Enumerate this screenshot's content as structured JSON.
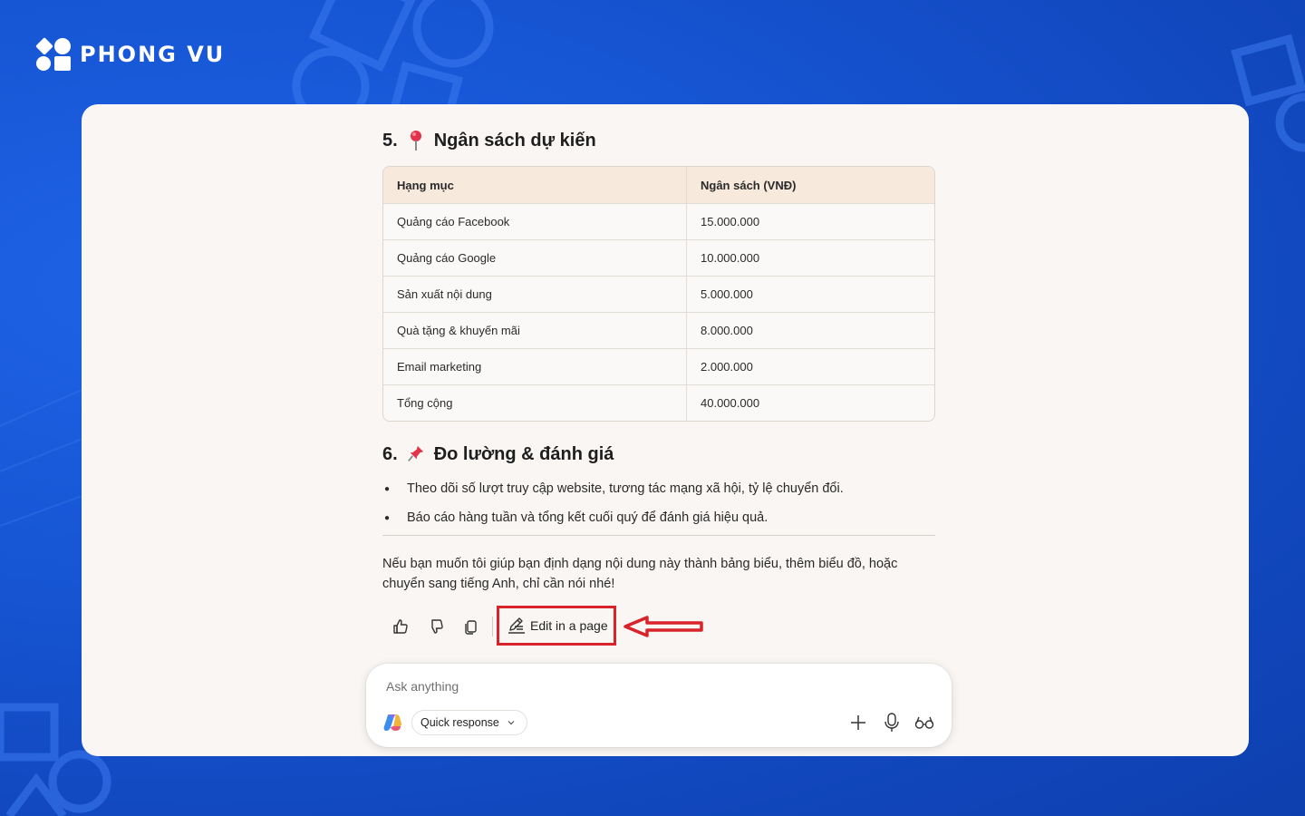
{
  "brand": {
    "name": "PHONG VU"
  },
  "section5": {
    "number": "5.",
    "title": "Ngân sách dự kiến",
    "icon": "pushpin-round-icon",
    "table": {
      "headers": [
        "Hạng mục",
        "Ngân sách (VNĐ)"
      ],
      "rows": [
        [
          "Quảng cáo Facebook",
          "15.000.000"
        ],
        [
          "Quảng cáo Google",
          "10.000.000"
        ],
        [
          "Sản xuất nội dung",
          "5.000.000"
        ],
        [
          "Quà tặng & khuyến mãi",
          "8.000.000"
        ],
        [
          "Email marketing",
          "2.000.000"
        ],
        [
          "Tổng cộng",
          "40.000.000"
        ]
      ]
    }
  },
  "section6": {
    "number": "6.",
    "title": "Đo lường & đánh giá",
    "icon": "pushpin-icon",
    "bullets": [
      "Theo dõi số lượt truy cập website, tương tác mạng xã hội, tỷ lệ chuyển đổi.",
      "Báo cáo hàng tuần và tổng kết cuối quý để đánh giá hiệu quả."
    ]
  },
  "closing": "Nếu bạn muốn tôi giúp bạn định dạng nội dung này thành bảng biểu, thêm biểu đồ, hoặc chuyển sang tiếng Anh, chỉ cần nói nhé!",
  "actions": {
    "icons": [
      "thumbs-up-icon",
      "thumbs-down-icon",
      "copy-icon"
    ],
    "edit_label": "Edit in a page"
  },
  "composer": {
    "placeholder": "Ask anything",
    "mode": "Quick response",
    "icons": [
      "plus-icon",
      "microphone-icon",
      "glasses-icon"
    ]
  },
  "colors": {
    "background": "#1757d6",
    "card": "#f9f6f3",
    "table_header": "#f7e9dc",
    "highlight": "#d8232a"
  }
}
